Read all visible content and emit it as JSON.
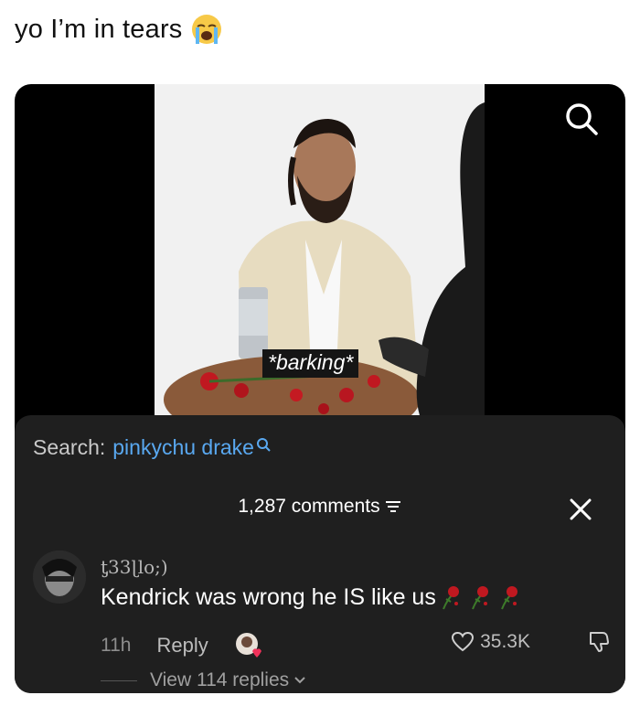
{
  "post": {
    "caption": "yo I’m in tears",
    "caption_emoji": "loudly-crying-face-emoji"
  },
  "video": {
    "subtitle": "*barking*",
    "search_icon": "search-icon"
  },
  "comments_sheet": {
    "search_label": "Search:",
    "search_query": "pinkychu drake",
    "comments_count": "1,287 comments",
    "filter_icon": "filter-icon",
    "close_icon": "close-icon",
    "comment": {
      "username": "ƫ33ɭlo;)",
      "text": "Kendrick was wrong he IS like us",
      "text_emojis": "wilted-rose-emoji",
      "time": "11h",
      "reply_label": "Reply",
      "likes": "35.3K",
      "view_replies": "View 114 replies"
    }
  },
  "colors": {
    "sheet_bg": "#1f1f1f",
    "search_query": "#59a8f0",
    "card_bg": "#000000"
  }
}
